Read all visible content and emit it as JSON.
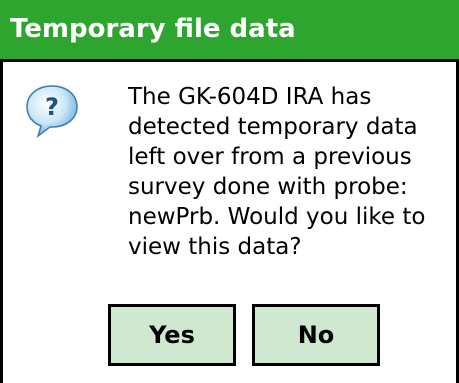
{
  "dialog": {
    "title": "Temporary file data",
    "icon": "question-bubble-icon",
    "message": "The GK-604D IRA has\ndetected temporary data\nleft over from a previous\nsurvey done with probe:\nnewPrb. Would you like to\nview this data?",
    "buttons": {
      "yes_label": "Yes",
      "no_label": "No"
    }
  },
  "colors": {
    "title_bar": "#2ea52e",
    "title_text": "#ffffff",
    "button_fill": "#cfe8cf",
    "border": "#000000"
  }
}
